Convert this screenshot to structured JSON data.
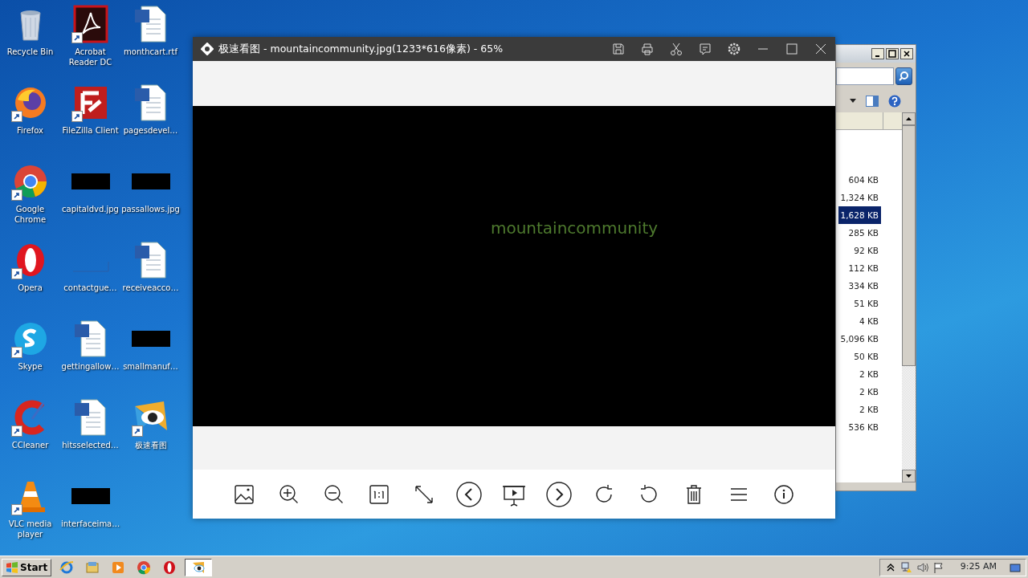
{
  "desktop": {
    "icons": [
      {
        "label": "Recycle Bin",
        "kind": "recycle",
        "shortcut": false
      },
      {
        "label": "Firefox",
        "kind": "firefox",
        "shortcut": true
      },
      {
        "label": "Google Chrome",
        "kind": "chrome",
        "shortcut": true
      },
      {
        "label": "Opera",
        "kind": "opera",
        "shortcut": true
      },
      {
        "label": "Skype",
        "kind": "skype",
        "shortcut": true
      },
      {
        "label": "CCleaner",
        "kind": "ccleaner",
        "shortcut": true
      },
      {
        "label": "VLC media player",
        "kind": "vlc",
        "shortcut": true
      },
      {
        "label": "Acrobat Reader DC",
        "kind": "pdf",
        "shortcut": true
      },
      {
        "label": "FileZilla Client",
        "kind": "filezilla",
        "shortcut": true
      },
      {
        "label": "capitaldvd.jpg",
        "kind": "image",
        "shortcut": false
      },
      {
        "label": "contactgue…",
        "kind": "blank",
        "shortcut": false
      },
      {
        "label": "gettingallow…",
        "kind": "word",
        "shortcut": false
      },
      {
        "label": "hitsselected…",
        "kind": "word",
        "shortcut": false
      },
      {
        "label": "interfaceima…",
        "kind": "image",
        "shortcut": false
      },
      {
        "label": "monthcart.rtf",
        "kind": "word",
        "shortcut": false
      },
      {
        "label": "pagesdevel…",
        "kind": "word",
        "shortcut": false
      },
      {
        "label": "passallows.jpg",
        "kind": "image",
        "shortcut": false
      },
      {
        "label": "receiveacco…",
        "kind": "word",
        "shortcut": false
      },
      {
        "label": "smallmanuf…",
        "kind": "image",
        "shortcut": false
      },
      {
        "label": "极速看图",
        "kind": "viewer",
        "shortcut": true
      }
    ]
  },
  "viewer": {
    "title": "极速看图 - mountaincommunity.jpg(1233*616像素) - 65%",
    "image_text": "mountaincommunity"
  },
  "explorer": {
    "sizes": [
      {
        "text": "604 KB",
        "selected": false
      },
      {
        "text": "1,324 KB",
        "selected": false
      },
      {
        "text": "1,628 KB",
        "selected": true
      },
      {
        "text": "285 KB",
        "selected": false
      },
      {
        "text": "92 KB",
        "selected": false
      },
      {
        "text": "112 KB",
        "selected": false
      },
      {
        "text": "334 KB",
        "selected": false
      },
      {
        "text": "51 KB",
        "selected": false
      },
      {
        "text": "4 KB",
        "selected": false
      },
      {
        "text": "5,096 KB",
        "selected": false
      },
      {
        "text": "50 KB",
        "selected": false
      },
      {
        "text": "2 KB",
        "selected": false
      },
      {
        "text": "2 KB",
        "selected": false
      },
      {
        "text": "2 KB",
        "selected": false
      },
      {
        "text": "536 KB",
        "selected": false
      }
    ]
  },
  "taskbar": {
    "start": "Start",
    "clock": "9:25 AM"
  }
}
